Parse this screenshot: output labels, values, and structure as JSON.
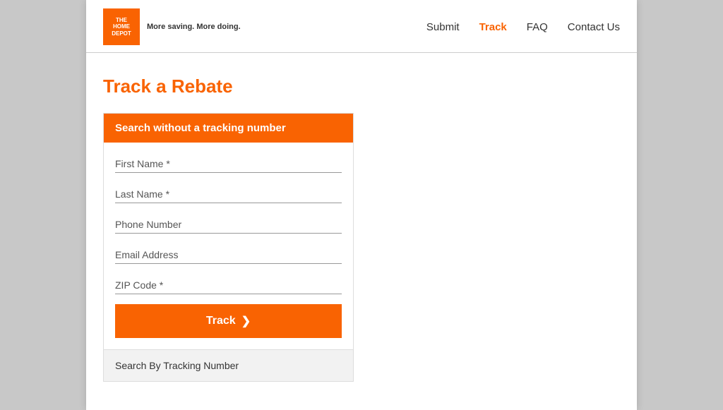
{
  "header": {
    "logo": {
      "line1": "THE",
      "line2": "HOME",
      "line3": "DEPOT",
      "tagline_start": "More saving.",
      "tagline_bold": "More doing."
    },
    "nav": {
      "submit": "Submit",
      "track": "Track",
      "faq": "FAQ",
      "contact": "Contact Us"
    }
  },
  "main": {
    "page_title": "Track a Rebate",
    "form": {
      "section_header": "Search without a tracking number",
      "fields": {
        "first_name": "First Name *",
        "last_name": "Last Name *",
        "phone": "Phone Number",
        "email": "Email Address",
        "zip": "ZIP Code *"
      },
      "track_button": "Track",
      "track_arrow": "❯",
      "tracking_tab": "Search By Tracking Number"
    }
  }
}
